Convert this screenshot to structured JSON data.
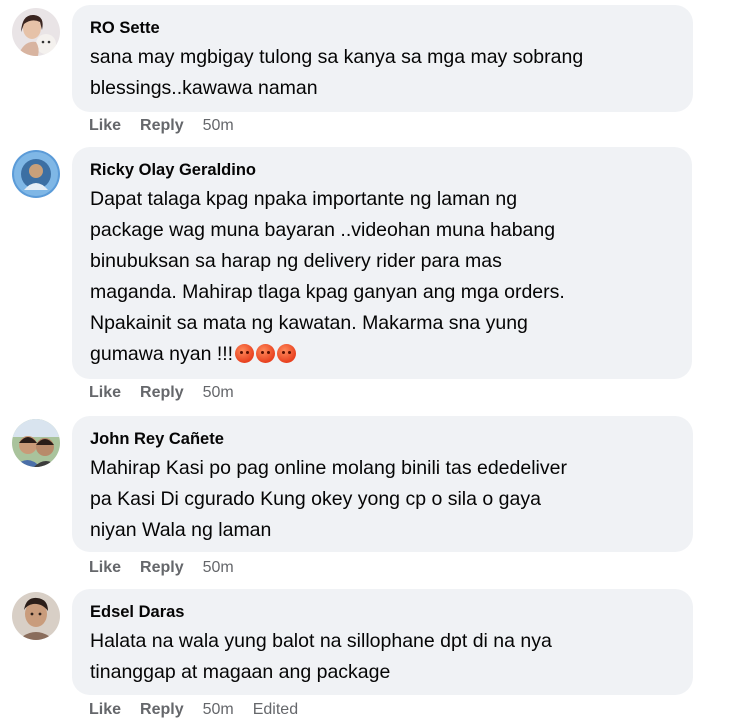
{
  "comments": [
    {
      "author": "RO Sette",
      "lines": [
        "sana may mgbigay tulong sa kanya sa mga may sobrang",
        "blessings..kawawa naman"
      ],
      "actions": {
        "like": "Like",
        "reply": "Reply",
        "time": "50m"
      }
    },
    {
      "author": "Ricky Olay Geraldino",
      "lines": [
        "Dapat talaga kpag npaka importante ng laman ng",
        "package wag muna bayaran ..videohan muna habang",
        "binubuksan sa harap ng delivery rider para mas",
        "maganda. Mahirap tlaga kpag ganyan ang mga orders.",
        "Npakainit sa mata ng kawatan. Makarma sna yung",
        "gumawa nyan !!!"
      ],
      "emojis": [
        "angry-face-emoji",
        "angry-face-emoji",
        "angry-face-emoji"
      ],
      "actions": {
        "like": "Like",
        "reply": "Reply",
        "time": "50m"
      }
    },
    {
      "author": "John Rey Cañete",
      "lines": [
        "Mahirap Kasi po pag online molang binili tas ededeliver",
        "pa Kasi Di cgurado Kung okey yong cp o sila o gaya",
        "niyan Wala ng laman"
      ],
      "actions": {
        "like": "Like",
        "reply": "Reply",
        "time": "50m"
      }
    },
    {
      "author": "Edsel Daras",
      "lines": [
        "Halata na wala yung balot na sillophane dpt di na nya",
        "tinanggap at magaan ang package"
      ],
      "actions": {
        "like": "Like",
        "reply": "Reply",
        "time": "50m",
        "edited": "Edited"
      }
    }
  ]
}
